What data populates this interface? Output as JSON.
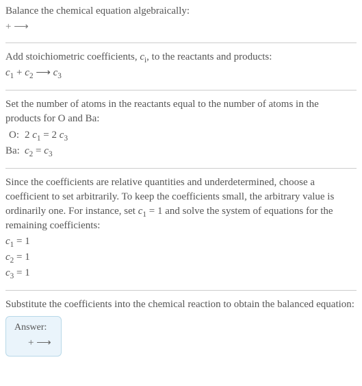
{
  "section1": {
    "line1": "Balance the chemical equation algebraically:",
    "line2": " +  ⟶ "
  },
  "section2": {
    "line1_pre": "Add stoichiometric coefficients, ",
    "line1_ci": "c",
    "line1_ci_sub": "i",
    "line1_post": ", to the reactants and products:",
    "eq_c1": "c",
    "eq_c1_sub": "1",
    "eq_plus": "  + ",
    "eq_c2": "c",
    "eq_c2_sub": "2",
    "eq_arrow": "   ⟶ ",
    "eq_c3": "c",
    "eq_c3_sub": "3"
  },
  "section3": {
    "line1": "Set the number of atoms in the reactants equal to the number of atoms in the products for O and Ba:",
    "atoms": [
      {
        "label": "O:",
        "lhs_coef": "2 ",
        "lhs_c": "c",
        "lhs_sub": "1",
        "eq": " = 2 ",
        "rhs_c": "c",
        "rhs_sub": "3"
      },
      {
        "label": "Ba:",
        "lhs_coef": "",
        "lhs_c": "c",
        "lhs_sub": "2",
        "eq": " = ",
        "rhs_c": "c",
        "rhs_sub": "3"
      }
    ]
  },
  "section4": {
    "line1_pre": "Since the coefficients are relative quantities and underdetermined, choose a coefficient to set arbitrarily. To keep the coefficients small, the arbitrary value is ordinarily one. For instance, set ",
    "line1_c": "c",
    "line1_sub": "1",
    "line1_post": " = 1 and solve the system of equations for the remaining coefficients:",
    "coeffs": [
      {
        "c": "c",
        "sub": "1",
        "val": " = 1"
      },
      {
        "c": "c",
        "sub": "2",
        "val": " = 1"
      },
      {
        "c": "c",
        "sub": "3",
        "val": " = 1"
      }
    ]
  },
  "section5": {
    "line1": "Substitute the coefficients into the chemical reaction to obtain the balanced equation:"
  },
  "answer": {
    "label": "Answer:",
    "content": " +  ⟶ "
  }
}
